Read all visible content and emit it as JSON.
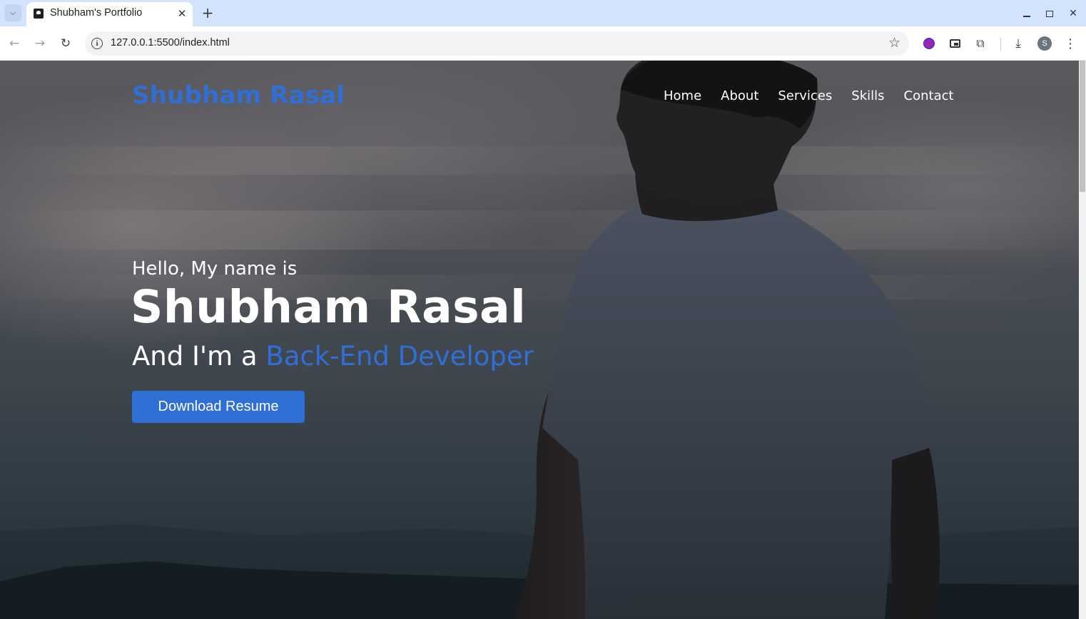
{
  "browser": {
    "tab_title": "Shubham's Portfolio",
    "url": "127.0.0.1:5500/index.html",
    "profile_initial": "S",
    "icons": {
      "tab_menu": "chevron-down-icon",
      "close": "close-icon",
      "new_tab": "plus-icon",
      "back": "arrow-left-icon",
      "forward": "arrow-right-icon",
      "reload": "reload-icon",
      "site_info": "info-icon",
      "bookmark": "star-icon",
      "downloads": "download-icon",
      "menu": "kebab-menu-icon"
    }
  },
  "site": {
    "logo": "Shubham Rasal",
    "nav": [
      "Home",
      "About",
      "Services",
      "Skills",
      "Contact"
    ],
    "hero": {
      "greeting": "Hello, My name is",
      "name": "Shubham Rasal",
      "role_prefix": "And I'm a ",
      "role": "Back-End Developer",
      "button": "Download Resume"
    },
    "colors": {
      "accent": "#2f6fd6",
      "text": "#ffffff"
    }
  }
}
